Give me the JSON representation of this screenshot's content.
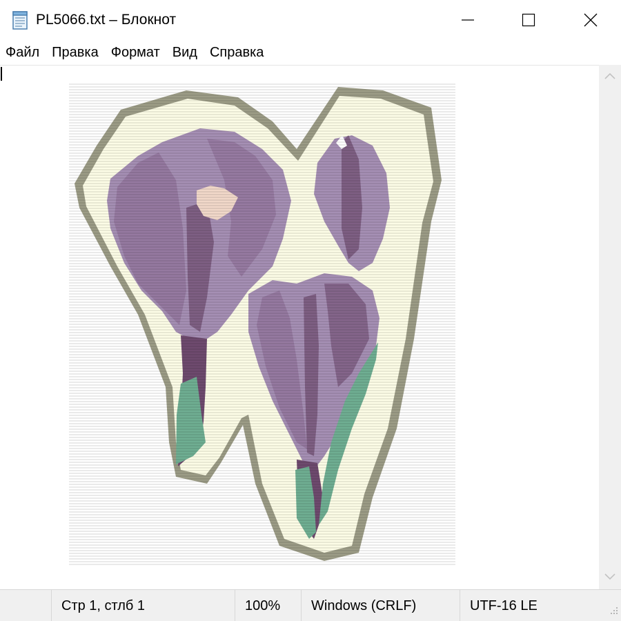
{
  "window": {
    "title": "PL5066.txt – Блокнот",
    "icon": "notepad-icon",
    "controls": [
      "minimize-icon",
      "maximize-icon",
      "close-icon"
    ]
  },
  "menu": {
    "items": [
      {
        "label": "Файл"
      },
      {
        "label": "Правка"
      },
      {
        "label": "Формат"
      },
      {
        "label": "Вид"
      },
      {
        "label": "Справка"
      }
    ]
  },
  "editor": {
    "content_description_visual": "crocus-illustration",
    "scroll_icons": [
      "chevron-up-icon",
      "chevron-down-icon"
    ]
  },
  "statusbar": {
    "position": "Стр 1, стлб 1",
    "zoom": "100%",
    "line_endings": "Windows (CRLF)",
    "encoding": "UTF-16 LE"
  },
  "colors": {
    "petal": "#a58fb4",
    "petal_dark": "#6e4a6e",
    "leaf": "#6fae92",
    "halo": "#fcfce6",
    "outline": "#9c9c86"
  }
}
